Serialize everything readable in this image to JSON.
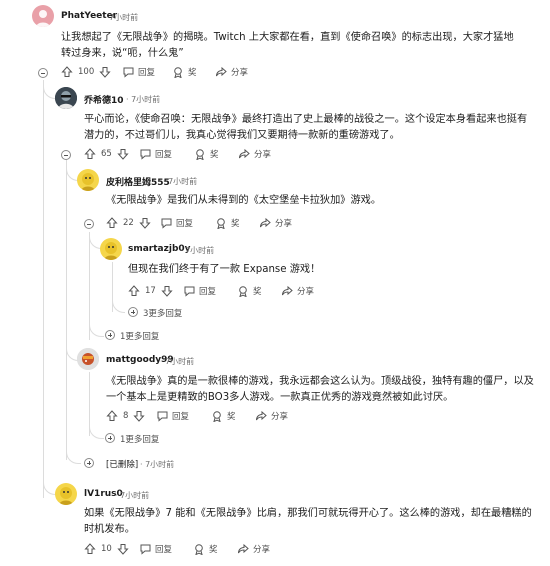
{
  "comments": [
    {
      "user": "PhatYeeter",
      "time": "7小时前",
      "text": "让我想起了《无限战争》的揭晓。Twitch 上大家都在看，直到《使命召唤》的标志出现，大家才猛地转过身来，说“呃，什么鬼”",
      "votes": "100"
    },
    {
      "user": "乔希德10",
      "time": "7小时前",
      "text": "平心而论，《使命召唤：无限战争》最终打造出了史上最棒的战役之一。这个设定本身看起来也挺有潜力的，不过哥们儿，我真心觉得我们又要期待一款新的重磅游戏了。",
      "votes": "65"
    },
    {
      "user": "皮利格里姆555",
      "time": "7小时前",
      "text": "《无限战争》是我们从未得到的《太空堡垒卡拉狄加》游戏。",
      "votes": "22"
    },
    {
      "user": "smartazjb0y",
      "time": "7小时前",
      "text": "但现在我们终于有了一款 Expanse 游戏！",
      "votes": "17"
    },
    {
      "user": "mattgoody99",
      "time": "7小时前",
      "text": "《无限战争》真的是一款很棒的游戏，我永远都会这么认为。顶级战役，独特有趣的僵尸，以及一个基本上是更精致的BO3多人游戏。一款真正优秀的游戏竟然被如此讨厌。",
      "votes": "8"
    },
    {
      "user": "lV1rus0",
      "time": "7小时前",
      "text": "如果《无限战争》7 能和《无限战争》比肩，那我们可就玩得开心了。这么棒的游戏，却在最糟糕的时机发布。",
      "votes": "10"
    }
  ],
  "deleted": {
    "label": "[已删除]",
    "time": "7小时前"
  },
  "labels": {
    "reply": "回复",
    "award": "奖",
    "share": "分享"
  },
  "more": {
    "m1": "3更多回复",
    "m2": "1更多回复",
    "m3": "1更多回复"
  },
  "colors": {
    "accent": "#ff4500",
    "line": "#dcdcdc"
  }
}
